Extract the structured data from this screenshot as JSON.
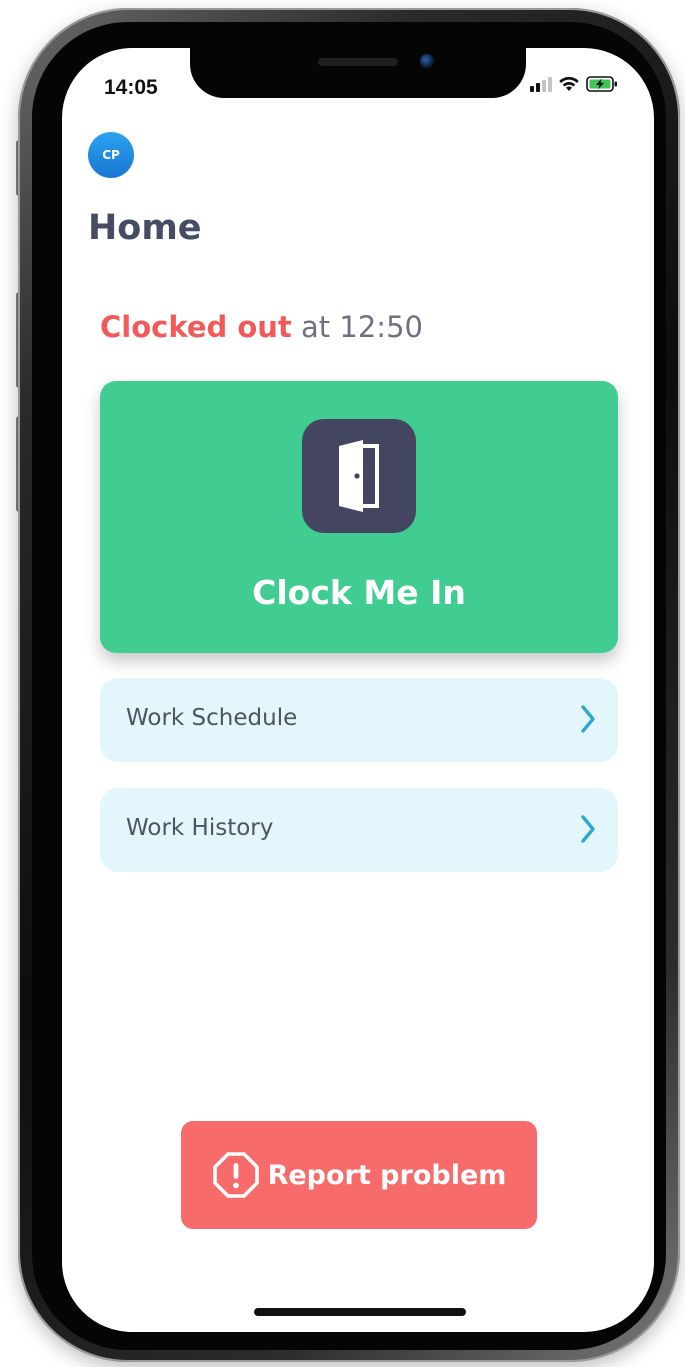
{
  "status_bar": {
    "time": "14:05",
    "icons": [
      "cellular-signal-icon",
      "wifi-icon",
      "battery-charging-icon"
    ]
  },
  "header": {
    "avatar_initials": "CP",
    "title": "Home"
  },
  "clock_status": {
    "state": "Clocked out",
    "suffix": "at 12:50"
  },
  "clock_card": {
    "icon": "door-icon",
    "label": "Clock Me In"
  },
  "menu": [
    {
      "label": "Work Schedule",
      "icon": "chevron-right-icon"
    },
    {
      "label": "Work History",
      "icon": "chevron-right-icon"
    }
  ],
  "report": {
    "icon": "alert-octagon-icon",
    "label": "Report problem"
  },
  "colors": {
    "clock_card": "#41cd92",
    "clocked_out": "#f25a5a",
    "report_button": "#f76b6b",
    "menu_row": "#e2f6fc",
    "chevron": "#2fa7cf",
    "title": "#464c63",
    "door_tile": "#444560"
  }
}
